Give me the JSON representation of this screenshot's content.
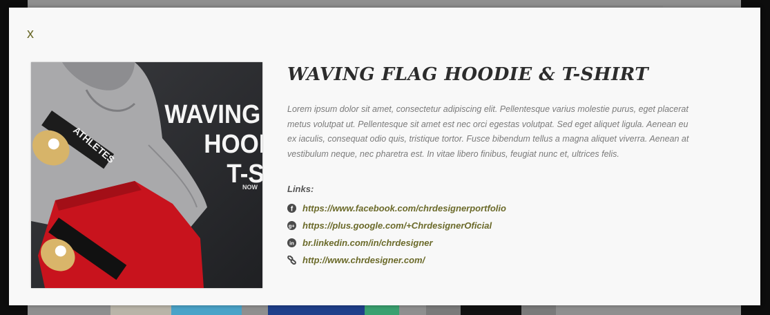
{
  "modal": {
    "close_label": "x",
    "title": "WAVING FLAG HOODIE & T-SHIRT",
    "description": "Lorem ipsum dolor sit amet, consectetur adipiscing elit. Pellentesque varius molestie purus, eget placerat metus volutpat ut. Pellentesque sit amet est nec orci egestas volutpat. Sed eget aliquet ligula. Aenean eu ex iaculis, consequat odio quis, tristique tortor. Fusce bibendum tellus a magna aliquet viverra. Aenean at vestibulum neque, nec pharetra est. In vitae libero finibus, feugiat nunc et, ultrices felis.",
    "links_label": "Links:",
    "links": [
      {
        "icon": "facebook-icon",
        "text": "https://www.facebook.com/chrdesignerportfolio"
      },
      {
        "icon": "google-plus-icon",
        "text": "https://plus.google.com/+ChrdesignerOficial"
      },
      {
        "icon": "linkedin-icon",
        "text": "br.linkedin.com/in/chrdesigner"
      },
      {
        "icon": "link-icon",
        "text": "http://www.chrdesigner.com/"
      }
    ],
    "image": {
      "headline_lines": [
        "WAVING F",
        "HOOD",
        "T-S"
      ],
      "subline": "NOW",
      "shirt_text": "ATHLETES"
    }
  },
  "colors": {
    "accent": "#6b6a2a",
    "title": "#2c2c2c",
    "body_text": "#7a7a7a",
    "modal_bg": "#f8f8f8",
    "overlay": "#0d0d0d"
  }
}
